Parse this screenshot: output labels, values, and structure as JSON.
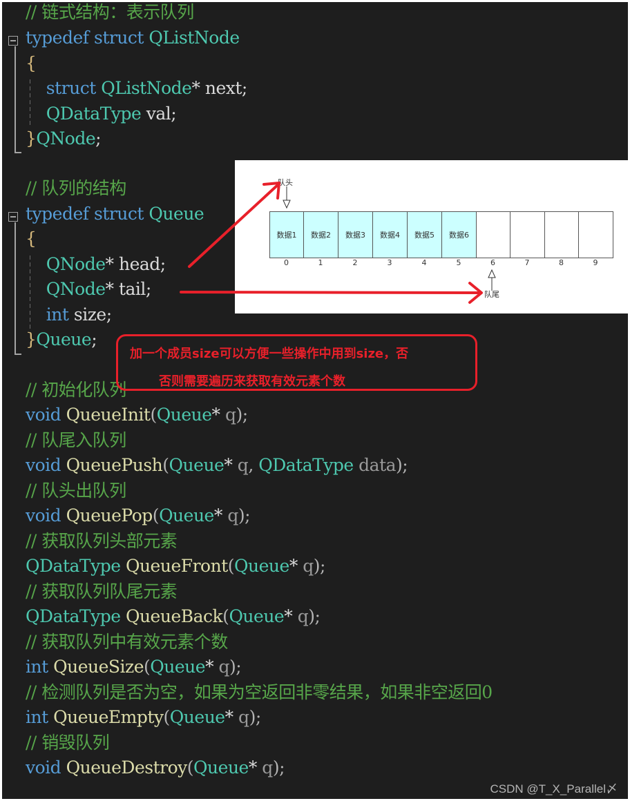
{
  "code": {
    "lines": [
      {
        "id": "c1",
        "tokens": [
          {
            "t": "// 链式结构：表示队列",
            "c": "cm"
          }
        ]
      },
      {
        "id": "l2",
        "tokens": [
          {
            "t": "typedef",
            "c": "kw"
          },
          {
            "t": " "
          },
          {
            "t": "struct",
            "c": "kw"
          },
          {
            "t": " "
          },
          {
            "t": "QListNode",
            "c": "ty"
          }
        ]
      },
      {
        "id": "l3",
        "tokens": [
          {
            "t": "{",
            "c": "br"
          }
        ]
      },
      {
        "id": "l4",
        "tokens": [
          {
            "t": "    "
          },
          {
            "t": "struct",
            "c": "kw"
          },
          {
            "t": " "
          },
          {
            "t": "QListNode",
            "c": "ty"
          },
          {
            "t": "* ",
            "c": "id"
          },
          {
            "t": "next;",
            "c": "id"
          }
        ]
      },
      {
        "id": "l5",
        "tokens": [
          {
            "t": "    "
          },
          {
            "t": "QDataType",
            "c": "ty"
          },
          {
            "t": " val;",
            "c": "id"
          }
        ]
      },
      {
        "id": "l6",
        "tokens": [
          {
            "t": "}",
            "c": "br"
          },
          {
            "t": "QNode",
            "c": "ty"
          },
          {
            "t": ";",
            "c": "id"
          }
        ]
      },
      {
        "id": "c2",
        "tokens": [
          {
            "t": "// 队列的结构",
            "c": "cm"
          }
        ]
      },
      {
        "id": "l8",
        "tokens": [
          {
            "t": "typedef",
            "c": "kw"
          },
          {
            "t": " "
          },
          {
            "t": "struct",
            "c": "kw"
          },
          {
            "t": " "
          },
          {
            "t": "Queue",
            "c": "ty"
          }
        ]
      },
      {
        "id": "l9",
        "tokens": [
          {
            "t": "{",
            "c": "br"
          }
        ]
      },
      {
        "id": "l10",
        "tokens": [
          {
            "t": "    "
          },
          {
            "t": "QNode",
            "c": "ty"
          },
          {
            "t": "* head;",
            "c": "id"
          }
        ]
      },
      {
        "id": "l11",
        "tokens": [
          {
            "t": "    "
          },
          {
            "t": "QNode",
            "c": "ty"
          },
          {
            "t": "* tail;",
            "c": "id"
          }
        ]
      },
      {
        "id": "l12",
        "tokens": [
          {
            "t": "    "
          },
          {
            "t": "int",
            "c": "kw"
          },
          {
            "t": " size;",
            "c": "id"
          }
        ]
      },
      {
        "id": "l13",
        "tokens": [
          {
            "t": "}",
            "c": "br"
          },
          {
            "t": "Queue",
            "c": "ty"
          },
          {
            "t": ";",
            "c": "id"
          }
        ]
      },
      {
        "id": "c3",
        "tokens": [
          {
            "t": "// 初始化队列",
            "c": "cm"
          }
        ]
      },
      {
        "id": "l15",
        "tokens": [
          {
            "t": "void",
            "c": "kw"
          },
          {
            "t": " "
          },
          {
            "t": "QueueInit",
            "c": "fn"
          },
          {
            "t": "(",
            "c": "pn"
          },
          {
            "t": "Queue",
            "c": "ty"
          },
          {
            "t": "* ",
            "c": "id"
          },
          {
            "t": "q",
            "c": "pr"
          },
          {
            "t": ");",
            "c": "pn"
          }
        ]
      },
      {
        "id": "c4",
        "tokens": [
          {
            "t": "// 队尾入队列",
            "c": "cm"
          }
        ]
      },
      {
        "id": "l17",
        "tokens": [
          {
            "t": "void",
            "c": "kw"
          },
          {
            "t": " "
          },
          {
            "t": "QueuePush",
            "c": "fn"
          },
          {
            "t": "(",
            "c": "pn"
          },
          {
            "t": "Queue",
            "c": "ty"
          },
          {
            "t": "* ",
            "c": "id"
          },
          {
            "t": "q",
            "c": "pr"
          },
          {
            "t": ", ",
            "c": "pn"
          },
          {
            "t": "QDataType",
            "c": "ty"
          },
          {
            "t": " "
          },
          {
            "t": "data",
            "c": "pr"
          },
          {
            "t": ");",
            "c": "pn"
          }
        ]
      },
      {
        "id": "c5",
        "tokens": [
          {
            "t": "// 队头出队列",
            "c": "cm"
          }
        ]
      },
      {
        "id": "l19",
        "tokens": [
          {
            "t": "void",
            "c": "kw"
          },
          {
            "t": " "
          },
          {
            "t": "QueuePop",
            "c": "fn"
          },
          {
            "t": "(",
            "c": "pn"
          },
          {
            "t": "Queue",
            "c": "ty"
          },
          {
            "t": "* ",
            "c": "id"
          },
          {
            "t": "q",
            "c": "pr"
          },
          {
            "t": ");",
            "c": "pn"
          }
        ]
      },
      {
        "id": "c6",
        "tokens": [
          {
            "t": "// 获取队列头部元素",
            "c": "cm"
          }
        ]
      },
      {
        "id": "l21",
        "tokens": [
          {
            "t": "QDataType",
            "c": "ty"
          },
          {
            "t": " "
          },
          {
            "t": "QueueFront",
            "c": "fn"
          },
          {
            "t": "(",
            "c": "pn"
          },
          {
            "t": "Queue",
            "c": "ty"
          },
          {
            "t": "* ",
            "c": "id"
          },
          {
            "t": "q",
            "c": "pr"
          },
          {
            "t": ");",
            "c": "pn"
          }
        ]
      },
      {
        "id": "c7",
        "tokens": [
          {
            "t": "// 获取队列队尾元素",
            "c": "cm"
          }
        ]
      },
      {
        "id": "l23",
        "tokens": [
          {
            "t": "QDataType",
            "c": "ty"
          },
          {
            "t": " "
          },
          {
            "t": "QueueBack",
            "c": "fn"
          },
          {
            "t": "(",
            "c": "pn"
          },
          {
            "t": "Queue",
            "c": "ty"
          },
          {
            "t": "* ",
            "c": "id"
          },
          {
            "t": "q",
            "c": "pr"
          },
          {
            "t": ");",
            "c": "pn"
          }
        ]
      },
      {
        "id": "c8",
        "tokens": [
          {
            "t": "// 获取队列中有效元素个数",
            "c": "cm"
          }
        ]
      },
      {
        "id": "l25",
        "tokens": [
          {
            "t": "int",
            "c": "kw"
          },
          {
            "t": " "
          },
          {
            "t": "QueueSize",
            "c": "fn"
          },
          {
            "t": "(",
            "c": "pn"
          },
          {
            "t": "Queue",
            "c": "ty"
          },
          {
            "t": "* ",
            "c": "id"
          },
          {
            "t": "q",
            "c": "pr"
          },
          {
            "t": ");",
            "c": "pn"
          }
        ]
      },
      {
        "id": "c9",
        "tokens": [
          {
            "t": "// 检测队列是否为空，如果为空返回非零结果，如果非空返回0",
            "c": "cm"
          }
        ]
      },
      {
        "id": "l27",
        "tokens": [
          {
            "t": "int",
            "c": "kw"
          },
          {
            "t": " "
          },
          {
            "t": "QueueEmpty",
            "c": "fn"
          },
          {
            "t": "(",
            "c": "pn"
          },
          {
            "t": "Queue",
            "c": "ty"
          },
          {
            "t": "* ",
            "c": "id"
          },
          {
            "t": "q",
            "c": "pr"
          },
          {
            "t": ");",
            "c": "pn"
          }
        ]
      },
      {
        "id": "c10",
        "tokens": [
          {
            "t": "// 销毁队列",
            "c": "cm"
          }
        ]
      },
      {
        "id": "l29",
        "tokens": [
          {
            "t": "void",
            "c": "kw"
          },
          {
            "t": " "
          },
          {
            "t": "QueueDestroy",
            "c": "fn"
          },
          {
            "t": "(",
            "c": "pn"
          },
          {
            "t": "Queue",
            "c": "ty"
          },
          {
            "t": "* ",
            "c": "id"
          },
          {
            "t": "q",
            "c": "pr"
          },
          {
            "t": ");",
            "c": "pn"
          }
        ]
      }
    ]
  },
  "diagram": {
    "head_label": "队头",
    "tail_label": "队尾",
    "cells": [
      "数据1",
      "数据2",
      "数据3",
      "数据4",
      "数据5",
      "数据6",
      "",
      "",
      "",
      ""
    ],
    "indices": [
      "0",
      "1",
      "2",
      "3",
      "4",
      "5",
      "6",
      "7",
      "8",
      "9"
    ],
    "filled_color": "#ccffff"
  },
  "callout": {
    "line1": "加一个成员size可以方便一些操作中用到size，否",
    "line2": "否则需要遍历来获取有效元素个数",
    "color": "#e8202a"
  },
  "watermark": "CSDN @T_X_Parallel〆"
}
